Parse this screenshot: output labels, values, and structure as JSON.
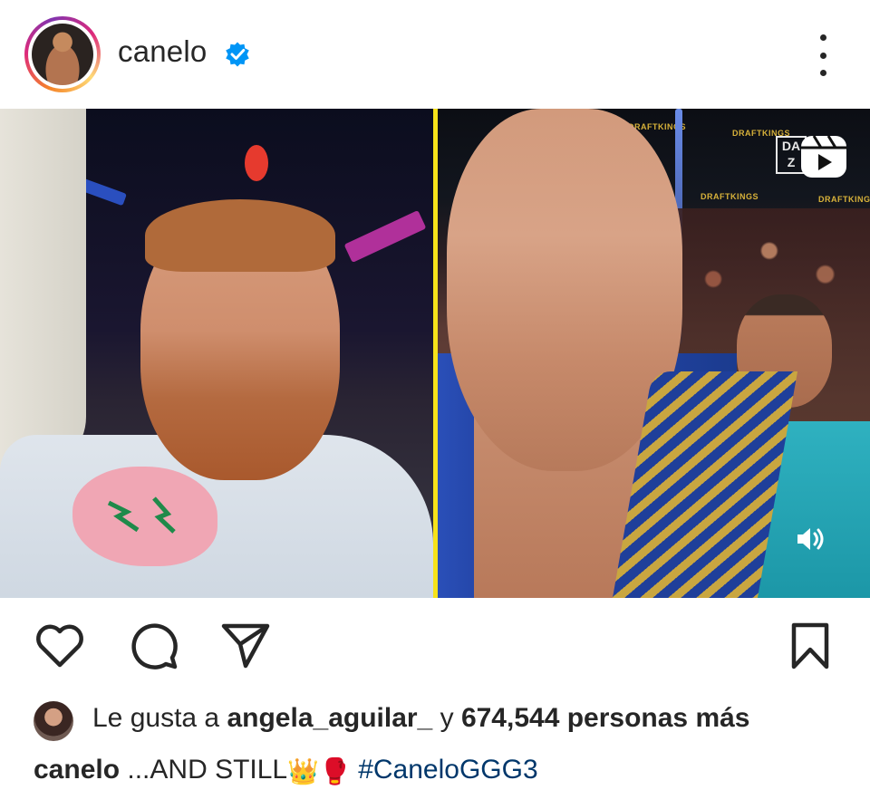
{
  "post": {
    "username": "canelo",
    "verified": true,
    "more_icon": "more-vertical-icon"
  },
  "media": {
    "overlay_mark": "DA Z",
    "sponsor_text": "DRAFTKINGS",
    "reels_icon": "reels-icon",
    "sound_icon": "speaker-icon",
    "divider_color": "#f6e21a"
  },
  "actions": {
    "like_icon": "heart-icon",
    "comment_icon": "comment-icon",
    "share_icon": "send-icon",
    "save_icon": "bookmark-icon"
  },
  "likes": {
    "prefix": "Le gusta a",
    "user": "angela_aguilar_",
    "connector": "y",
    "count_text": "674,544 personas más"
  },
  "caption": {
    "username": "canelo",
    "text": "...AND STILL",
    "emojis": "👑🥊",
    "hashtag": "#CaneloGGG3"
  },
  "colors": {
    "text": "#262626",
    "hashtag": "#00376b",
    "verified": "#0095f6"
  }
}
